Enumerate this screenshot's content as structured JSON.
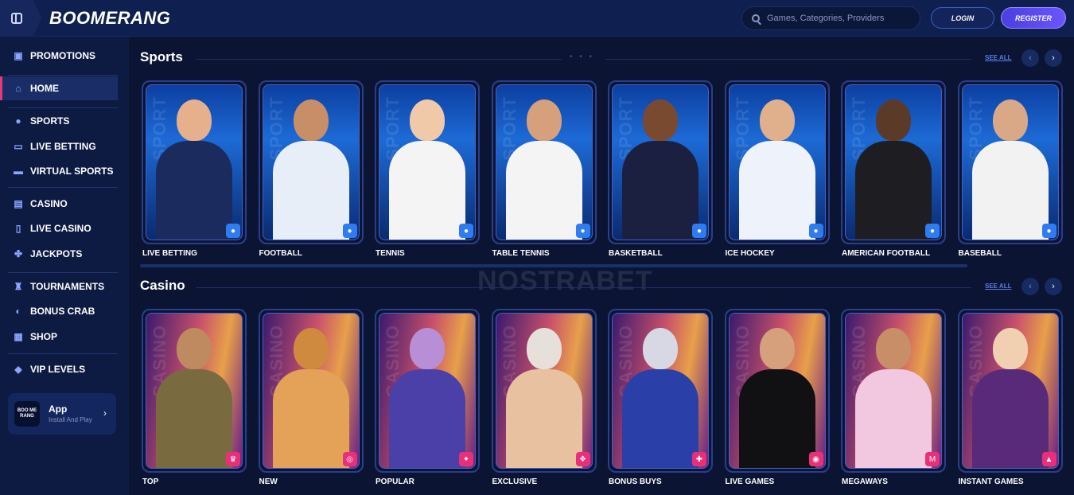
{
  "header": {
    "logo": "BOOMERANG",
    "search_placeholder": "Games, Categories, Providers",
    "login_label": "LOGIN",
    "register_label": "REGISTER"
  },
  "sidebar": {
    "groups": [
      [
        {
          "label": "PROMOTIONS",
          "icon": "gift-icon"
        }
      ],
      [
        {
          "label": "HOME",
          "icon": "home-icon",
          "active": true
        }
      ],
      [
        {
          "label": "SPORTS",
          "icon": "soccer-ball-icon"
        },
        {
          "label": "LIVE BETTING",
          "icon": "live-tv-icon"
        },
        {
          "label": "VIRTUAL SPORTS",
          "icon": "monitor-icon"
        }
      ],
      [
        {
          "label": "CASINO",
          "icon": "slot-machine-icon"
        },
        {
          "label": "LIVE CASINO",
          "icon": "cards-icon"
        },
        {
          "label": "JACKPOTS",
          "icon": "clover-icon"
        }
      ],
      [
        {
          "label": "TOURNAMENTS",
          "icon": "trophy-icon"
        },
        {
          "label": "BONUS CRAB",
          "icon": "crab-icon"
        },
        {
          "label": "SHOP",
          "icon": "basket-icon"
        }
      ],
      [
        {
          "label": "VIP LEVELS",
          "icon": "diamond-icon"
        }
      ]
    ],
    "app_card": {
      "logo": "BOO ME RANG",
      "title": "App",
      "subtitle": "Install And Play"
    }
  },
  "sports": {
    "title": "Sports",
    "see_all": "SEE ALL",
    "watermark": "SPORT",
    "cards": [
      {
        "label": "LIVE BETTING",
        "skin": "#e7b08c",
        "shirt": "#1b2b5e"
      },
      {
        "label": "FOOTBALL",
        "skin": "#c88e68",
        "shirt": "#e8eef8"
      },
      {
        "label": "TENNIS",
        "skin": "#f0c9a8",
        "shirt": "#f4f4f4"
      },
      {
        "label": "TABLE TENNIS",
        "skin": "#d6a07c",
        "shirt": "#f4f4f4"
      },
      {
        "label": "BASKETBALL",
        "skin": "#7a4a30",
        "shirt": "#1c2040"
      },
      {
        "label": "ICE HOCKEY",
        "skin": "#e0b08c",
        "shirt": "#eef2fa"
      },
      {
        "label": "AMERICAN FOOTBALL",
        "skin": "#5b3a28",
        "shirt": "#1e1e22"
      },
      {
        "label": "BASEBALL",
        "skin": "#d9a886",
        "shirt": "#f2f2f2"
      }
    ]
  },
  "casino": {
    "title": "Casino",
    "see_all": "SEE ALL",
    "watermark": "CASINO",
    "cards": [
      {
        "label": "TOP",
        "skin": "#c08a60",
        "shirt": "#7a6a40"
      },
      {
        "label": "NEW",
        "skin": "#d08a40",
        "shirt": "#e3a257"
      },
      {
        "label": "POPULAR",
        "skin": "#b88fd6",
        "shirt": "#4b3fa8"
      },
      {
        "label": "EXCLUSIVE",
        "skin": "#e6e0da",
        "shirt": "#e8c2a0"
      },
      {
        "label": "BONUS BUYS",
        "skin": "#d8d8e4",
        "shirt": "#2a3fa8"
      },
      {
        "label": "LIVE GAMES",
        "skin": "#d6a07c",
        "shirt": "#111114"
      },
      {
        "label": "MEGAWAYS",
        "skin": "#c88e68",
        "shirt": "#f2c8e0"
      },
      {
        "label": "INSTANT GAMES",
        "skin": "#f0d0b0",
        "shirt": "#5a2a7a"
      }
    ]
  },
  "watermark": "NOSTRABET",
  "colors": {
    "accent": "#e23a7b",
    "brand_blue": "#2f7cf0",
    "bg": "#0b1433"
  }
}
